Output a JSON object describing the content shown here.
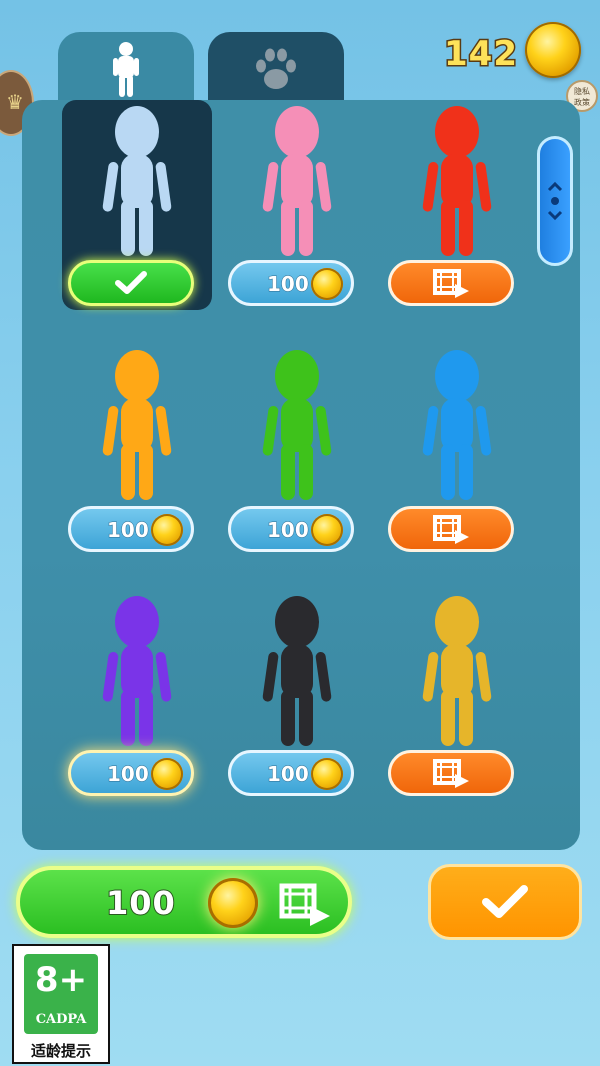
{
  "header": {
    "coin_count": "142",
    "privacy_text": "隐私\n政策"
  },
  "tabs": [
    {
      "icon": "person-icon",
      "active": true
    },
    {
      "icon": "paw-icon",
      "active": false
    }
  ],
  "skins": [
    {
      "color": "#b9d8f3",
      "action": "selected"
    },
    {
      "color": "#f58fb7",
      "action": "buy",
      "price": "100"
    },
    {
      "color": "#f0311a",
      "action": "watch-video"
    },
    {
      "color": "#ffa816",
      "action": "buy",
      "price": "100"
    },
    {
      "color": "#3ec21b",
      "action": "buy",
      "price": "100"
    },
    {
      "color": "#1f99ee",
      "action": "watch-video"
    },
    {
      "color": "#7a34e8",
      "action": "buy",
      "price": "100"
    },
    {
      "color": "#2a2a2e",
      "action": "buy",
      "price": "100"
    },
    {
      "color": "#e6b52a",
      "action": "watch-video"
    }
  ],
  "bottom": {
    "buy_price": "100"
  },
  "age_rating": {
    "rating": "8+",
    "org": "CADPA",
    "label": "适龄提示"
  },
  "colors": {
    "selected_green": "#2bbf22",
    "buy_blue": "#3da4d6",
    "video_orange": "#f0660a",
    "confirm_orange": "#ff9400",
    "coin_gold": "#ffd21a"
  }
}
